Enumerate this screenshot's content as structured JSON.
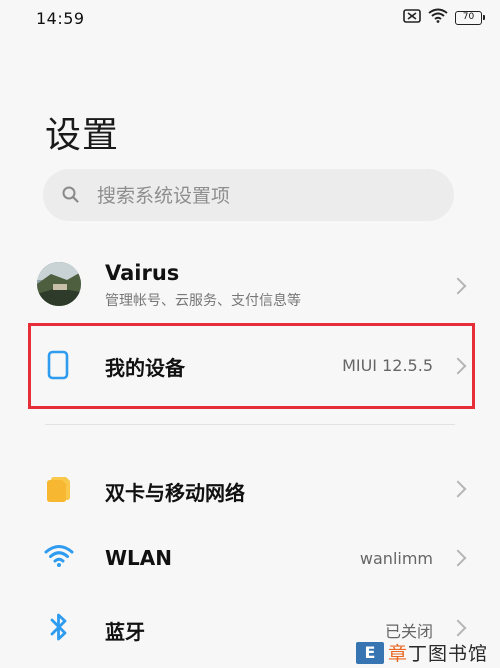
{
  "status_bar": {
    "time": "14:59",
    "battery": "70",
    "icons": [
      "sim-off-icon",
      "wifi-icon",
      "battery-icon"
    ]
  },
  "page": {
    "title": "设置"
  },
  "search": {
    "placeholder": "搜索系统设置项",
    "value": ""
  },
  "account": {
    "name": "Vairus",
    "subtitle": "管理帐号、云服务、支付信息等"
  },
  "settings": [
    {
      "title": "我的设备",
      "value": "MIUI 12.5.5",
      "icon": "phone-icon",
      "highlighted": true
    },
    {
      "title": "双卡与移动网络",
      "value": "",
      "icon": "sim-card-icon"
    },
    {
      "title": "WLAN",
      "value": "wanlimm",
      "icon": "wifi-icon"
    },
    {
      "title": "蓝牙",
      "value": "已关闭",
      "icon": "bluetooth-icon"
    }
  ],
  "watermark": {
    "logo": "E",
    "text_accent": "章",
    "text_rest": "丁图书馆"
  },
  "colors": {
    "accent_blue": "#2f9cf0",
    "sim_orange": "#f7b731",
    "highlight_red": "#e62e38"
  }
}
